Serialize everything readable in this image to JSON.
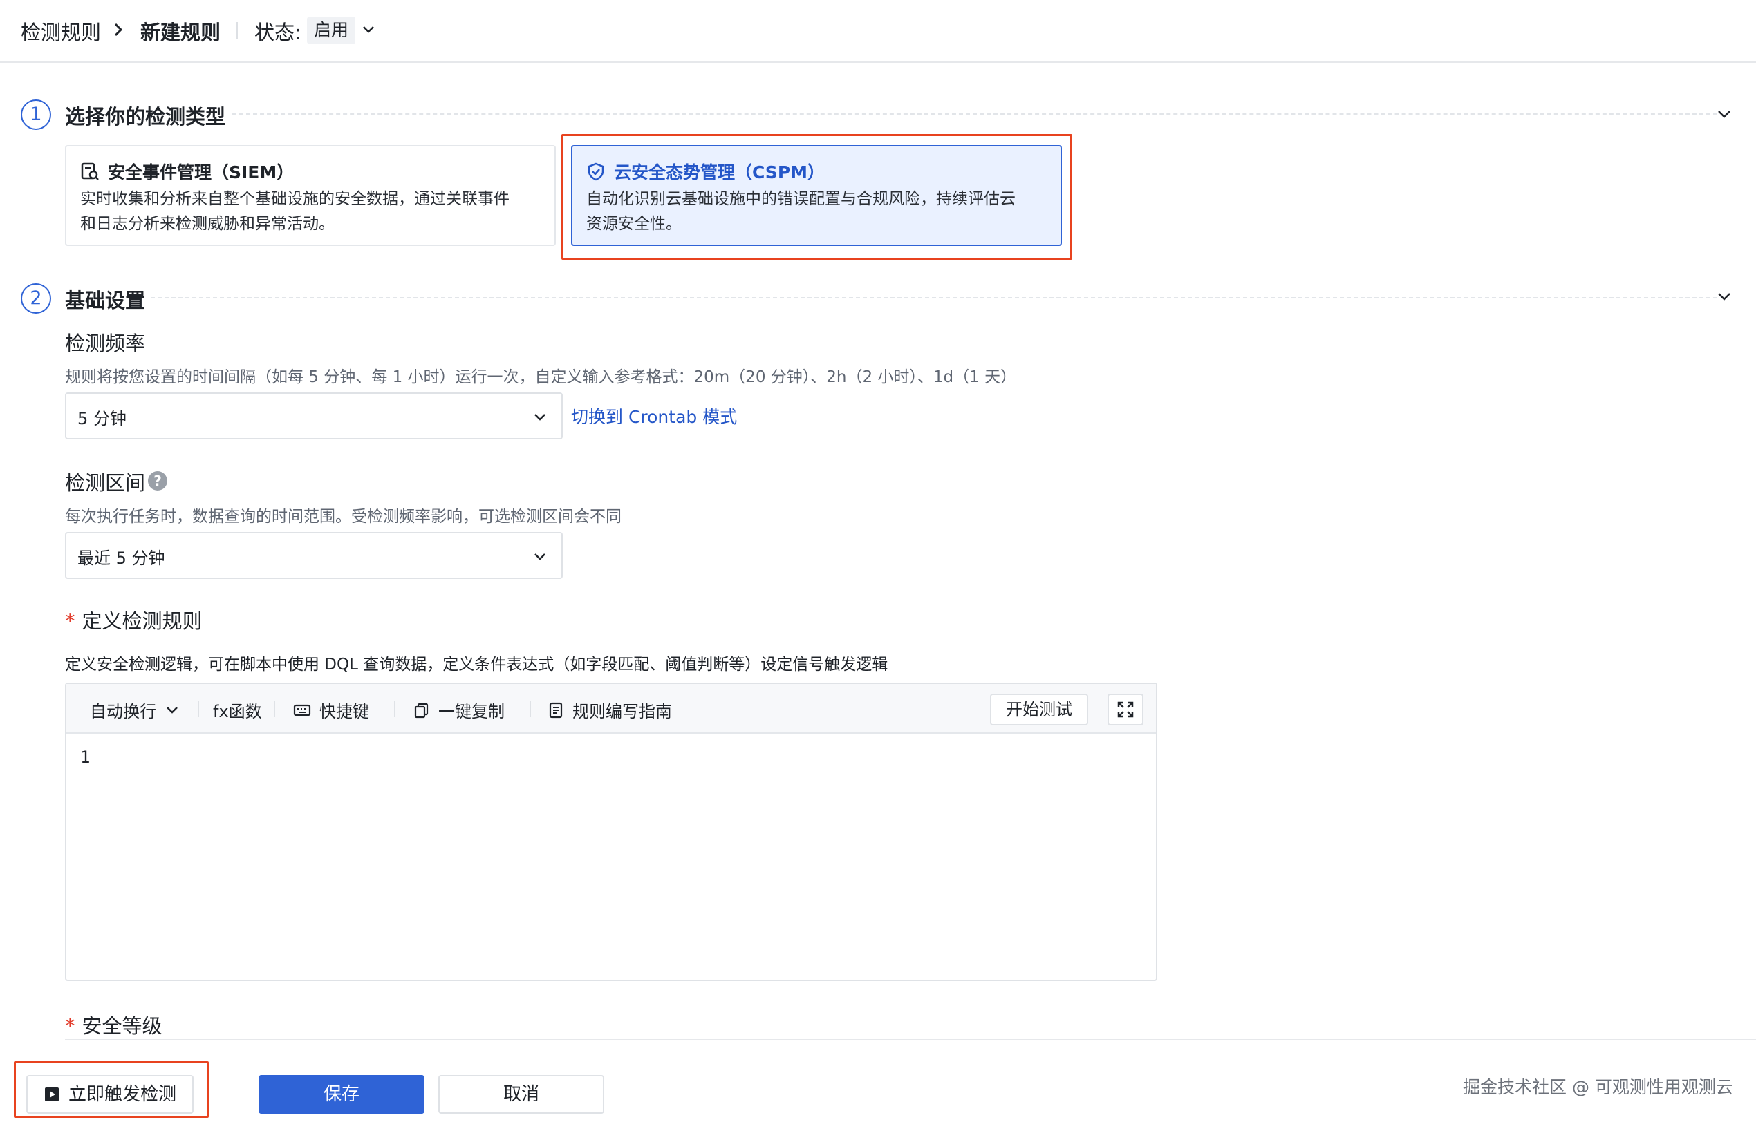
{
  "header": {
    "breadcrumb_root": "检测规则",
    "breadcrumb_current": "新建规则",
    "status_label": "状态:",
    "status_value": "启用"
  },
  "step1": {
    "number": "1",
    "title": "选择你的检测类型",
    "cards": [
      {
        "title": "安全事件管理（SIEM）",
        "desc_line1": "实时收集和分析来自整个基础设施的安全数据，通过关联事件",
        "desc_line2": "和日志分析来检测威胁和异常活动。",
        "selected": false
      },
      {
        "title": "云安全态势管理（CSPM）",
        "desc_line1": "自动化识别云基础设施中的错误配置与合规风险，持续评估云",
        "desc_line2": "资源安全性。",
        "selected": true
      }
    ]
  },
  "step2": {
    "number": "2",
    "title": "基础设置",
    "frequency": {
      "label": "检测频率",
      "help": "规则将按您设置的时间间隔（如每 5 分钟、每 1 小时）运行一次，自定义输入参考格式：20m（20 分钟）、2h（2 小时）、1d（1 天）",
      "value": "5 分钟",
      "crontab_link": "切换到 Crontab 模式"
    },
    "range": {
      "label": "检测区间",
      "help_icon": "?",
      "help": "每次执行任务时，数据查询的时间范围。受检测频率影响，可选检测区间会不同",
      "value": "最近 5 分钟"
    },
    "rule": {
      "required_mark": "*",
      "label": "定义检测规则",
      "help": "定义安全检测逻辑，可在脚本中使用 DQL 查询数据，定义条件表达式（如字段匹配、阈值判断等）设定信号触发逻辑"
    },
    "editor": {
      "wrap_label": "自动换行",
      "fx_label": "fx函数",
      "shortcut_label": "快捷键",
      "copy_label": "一键复制",
      "guide_label": "规则编写指南",
      "test_button": "开始测试",
      "line_number": "1"
    },
    "severity": {
      "required_mark": "*",
      "label": "安全等级"
    }
  },
  "footer": {
    "trigger_button": "立即触发检测",
    "save_button": "保存",
    "cancel_button": "取消",
    "watermark": "掘金技术社区 @ 可观测性用观测云"
  },
  "colors": {
    "accent": "#2f63d6",
    "highlight": "#e8431f",
    "selected_bg": "#eaf1ff"
  }
}
